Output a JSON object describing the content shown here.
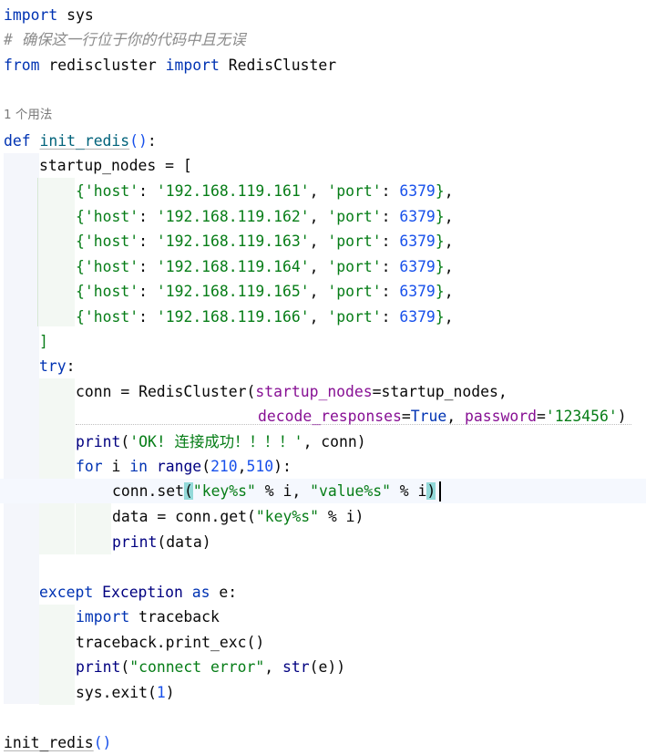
{
  "editor": {
    "usage_hint": "1 个用法",
    "lines": {
      "l1": {
        "kw": "import",
        "rest": " sys"
      },
      "l2": {
        "comment": "# 确保这一行位于你的代码中且无误"
      },
      "l3": {
        "kw1": "from",
        "mid": " rediscluster ",
        "kw2": "import",
        "rest": " RedisCluster"
      },
      "l5": {
        "kw": "def",
        "name": "init_redis",
        "open": "(",
        "close": ")",
        "colon": ":"
      },
      "l6": {
        "text": "startup_nodes = ["
      },
      "hosts": [
        {
          "host": "'192.168.119.161'",
          "port": "6379"
        },
        {
          "host": "'192.168.119.162'",
          "port": "6379"
        },
        {
          "host": "'192.168.119.163'",
          "port": "6379"
        },
        {
          "host": "'192.168.119.164'",
          "port": "6379"
        },
        {
          "host": "'192.168.119.165'",
          "port": "6379"
        },
        {
          "host": "'192.168.119.166'",
          "port": "6379"
        }
      ],
      "host_key": "'host'",
      "port_key": "'port'",
      "close_bracket": "]",
      "try": "try",
      "conn_line": {
        "pre": "conn = RedisCluster(",
        "p1": "startup_nodes",
        "eq1": "=startup_nodes,"
      },
      "conn_line2": {
        "p2": "decode_responses",
        "eq2": "=",
        "true": "True",
        "comma": ", ",
        "p3": "password",
        "eq3": "=",
        "pw": "'123456'",
        "close": ")"
      },
      "print_ok": {
        "fn": "print",
        "open": "(",
        "str": "'OK! 连接成功！！！！'",
        "rest": ", conn)"
      },
      "for_line": {
        "kw1": "for",
        "mid": " i ",
        "kw2": "in",
        "fn": " range",
        "open": "(",
        "n1": "210",
        "comma": ",",
        "n2": "510",
        "close": ")",
        "colon": ":"
      },
      "set_line": {
        "pre": "conn.set",
        "open": "(",
        "s1": "\"key%s\"",
        "mid": " % i, ",
        "s2": "\"value%s\"",
        "mid2": " % i",
        "close": ")"
      },
      "data_line": {
        "pre": "data = conn.get(",
        "s1": "\"key%s\"",
        "rest": " % i)"
      },
      "print_data": {
        "fn": "print",
        "open": "(",
        "arg": "data",
        "close": ")"
      },
      "except_line": {
        "kw1": "except",
        "cls": " Exception ",
        "kw2": "as",
        "rest": " e:"
      },
      "import_tb": {
        "kw": "import",
        "rest": " traceback"
      },
      "tb_print": {
        "text": "traceback.print_exc()"
      },
      "print_err": {
        "fn": "print",
        "open": "(",
        "str": "\"connect error\"",
        "comma": ", ",
        "fn2": "str",
        "rest": "(e))"
      },
      "sys_exit": {
        "pre": "sys.exit(",
        "num": "1",
        "close": ")"
      },
      "call": {
        "name": "init_redis",
        "parens": "()"
      }
    }
  }
}
